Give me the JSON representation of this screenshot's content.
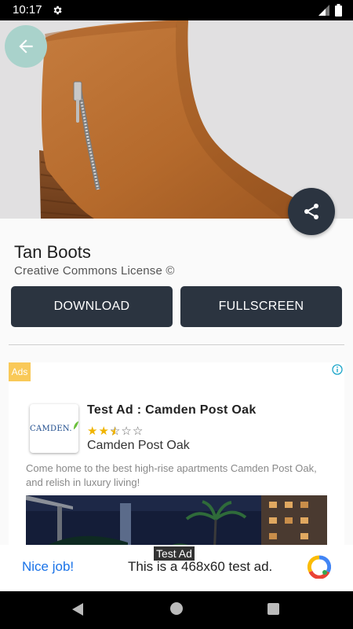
{
  "status_bar": {
    "time": "10:17",
    "icons": [
      "gear-icon",
      "signal-icon",
      "battery-icon"
    ]
  },
  "hero": {
    "icons": [
      "back-arrow-icon",
      "share-icon"
    ],
    "colors": {
      "back_button": "#a9d2cb",
      "share_button": "#2b3440"
    }
  },
  "wallpaper": {
    "title": "Tan Boots",
    "license": "Creative Commons License ©"
  },
  "actions": {
    "download_label": "DOWNLOAD",
    "fullscreen_label": "FULLSCREEN"
  },
  "native_ad": {
    "badge": "Ads",
    "logo_text": "CAMDEN.",
    "headline": "Test Ad : Camden Post Oak",
    "rating_stars": 2.5,
    "rating_max": 5,
    "advertiser": "Camden Post Oak",
    "body": "Come home to the best high-rise apartments Camden Post Oak, and relish in luxury living!",
    "icons": [
      "ad-info-icon"
    ]
  },
  "banner_ad": {
    "label": "Test Ad",
    "nice_job": "Nice job!",
    "text": "This is a 468x60 test ad.",
    "icons": [
      "ad-logo-icon"
    ]
  },
  "nav": {
    "icons": [
      "nav-back-icon",
      "nav-home-icon",
      "nav-recents-icon"
    ]
  }
}
